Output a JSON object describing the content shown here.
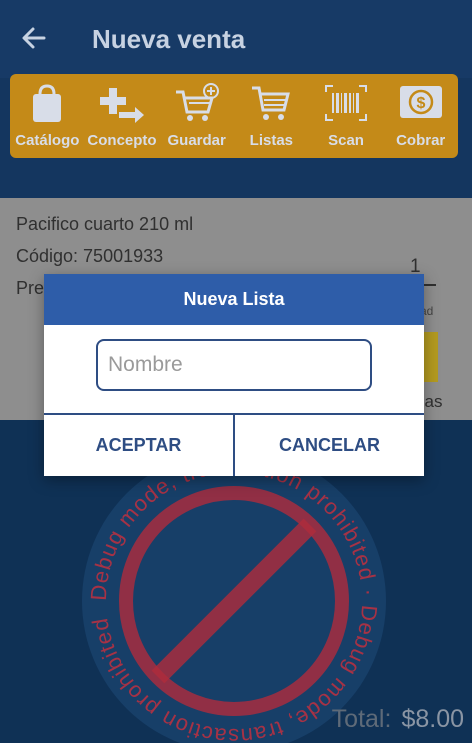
{
  "appbar": {
    "title": "Nueva venta",
    "back_icon": "arrow-left-icon"
  },
  "toolbar": {
    "items": [
      {
        "label": "Catálogo",
        "icon": "bag-icon"
      },
      {
        "label": "Concepto",
        "icon": "plus-arrow-icon"
      },
      {
        "label": "Guardar",
        "icon": "cart-add-icon"
      },
      {
        "label": "Listas",
        "icon": "cart-list-icon"
      },
      {
        "label": "Scan",
        "icon": "barcode-icon"
      },
      {
        "label": "Cobrar",
        "icon": "dollar-icon"
      }
    ]
  },
  "product": {
    "name": "Pacifico cuarto 210 ml",
    "code": "Código: 75001933",
    "price_label": "Pre",
    "quantity": "1",
    "quantity_label": "ad",
    "units_label": "zas"
  },
  "dialog": {
    "title": "Nueva Lista",
    "input_placeholder": "Nombre",
    "input_value": "",
    "accept_label": "ACEPTAR",
    "cancel_label": "CANCELAR"
  },
  "stamp": {
    "text": "Debug mode, transaction prohibited · Debug mode, transaction prohibited"
  },
  "footer": {
    "total_label": "Total:",
    "total_amount": "$8.00"
  },
  "colors": {
    "appbar": "#173a66",
    "toolbar": "#c48a18",
    "dialog_header": "#2e5da9",
    "dialog_button_text": "#2e4d83",
    "stamp": "#c03040"
  }
}
